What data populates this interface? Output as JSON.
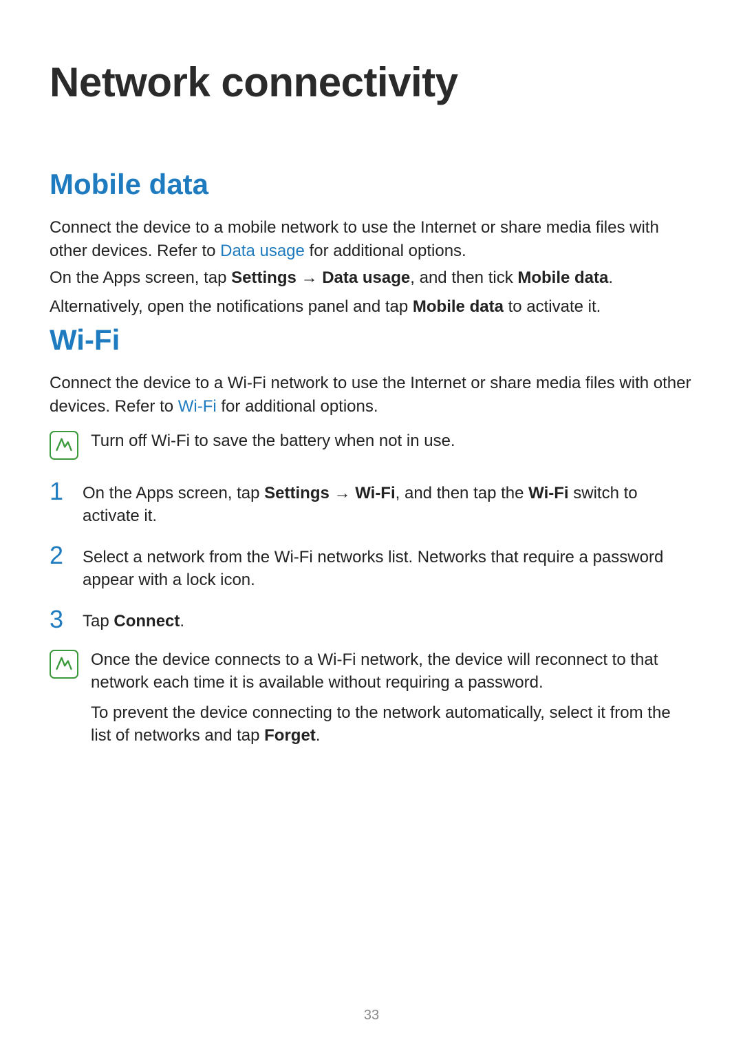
{
  "title": "Network connectivity",
  "sections": {
    "mobile": {
      "heading": "Mobile data",
      "p1_a": "Connect the device to a mobile network to use the Internet or share media files with other devices. Refer to ",
      "p1_link": "Data usage",
      "p1_b": " for additional options.",
      "p2_a": "On the Apps screen, tap ",
      "p2_b1": "Settings",
      "p2_arrow": " → ",
      "p2_b2": "Data usage",
      "p2_c": ", and then tick ",
      "p2_b3": "Mobile data",
      "p2_d": ".",
      "p3_a": "Alternatively, open the notifications panel and tap ",
      "p3_b": "Mobile data",
      "p3_c": " to activate it."
    },
    "wifi": {
      "heading": "Wi-Fi",
      "p1_a": "Connect the device to a Wi-Fi network to use the Internet or share media files with other devices. Refer to ",
      "p1_link": "Wi-Fi",
      "p1_b": " for additional options.",
      "note1": "Turn off Wi-Fi to save the battery when not in use.",
      "steps": [
        {
          "num": "1",
          "a": "On the Apps screen, tap ",
          "b1": "Settings",
          "arrow": " → ",
          "b2": "Wi-Fi",
          "c": ", and then tap the ",
          "b3": "Wi-Fi",
          "d": " switch to activate it."
        },
        {
          "num": "2",
          "a": "Select a network from the Wi-Fi networks list. Networks that require a password appear with a lock icon.",
          "b1": "",
          "arrow": "",
          "b2": "",
          "c": "",
          "b3": "",
          "d": ""
        },
        {
          "num": "3",
          "a": "Tap ",
          "b1": "Connect",
          "arrow": "",
          "b2": "",
          "c": ".",
          "b3": "",
          "d": ""
        }
      ],
      "note2_p1": "Once the device connects to a Wi-Fi network, the device will reconnect to that network each time it is available without requiring a password.",
      "note2_p2_a": "To prevent the device connecting to the network automatically, select it from the list of networks and tap ",
      "note2_p2_b": "Forget",
      "note2_p2_c": "."
    }
  },
  "pageNumber": "33"
}
